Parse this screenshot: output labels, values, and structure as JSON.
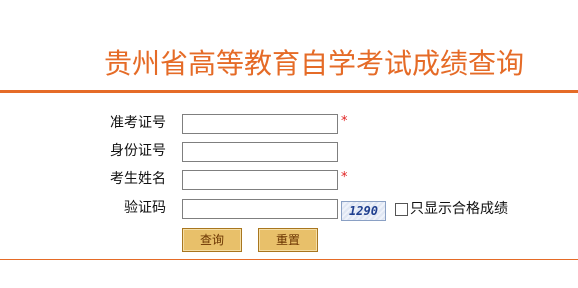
{
  "header": {
    "title": "贵州省高等教育自学考试成绩查询"
  },
  "form": {
    "fields": [
      {
        "label": "准考证号",
        "value": "",
        "required_mark": "*"
      },
      {
        "label": "身份证号",
        "value": ""
      },
      {
        "label": "考生姓名",
        "value": "",
        "required_mark": "*"
      },
      {
        "label": "验证码",
        "value": ""
      }
    ],
    "captcha_text": "1290",
    "checkbox": {
      "label": "只显示合格成绩",
      "checked": false
    }
  },
  "buttons": {
    "query_label": "查询",
    "reset_label": "重置"
  },
  "colors": {
    "accent": "#e56b27",
    "button_bg": "#e8c06a",
    "required": "#e02020"
  }
}
